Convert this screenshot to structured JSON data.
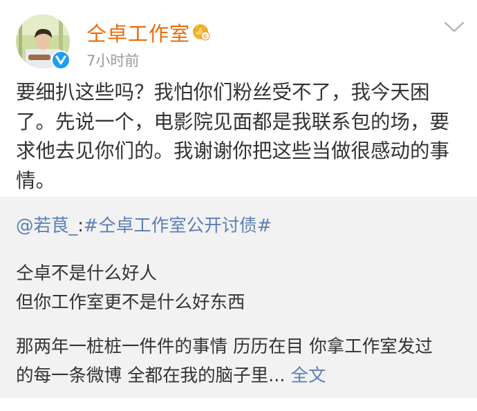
{
  "author": {
    "name": "仝卓工作室",
    "time": "7小时前",
    "vip_level": "6"
  },
  "post": {
    "line1": "要细扒这些吗？我怕你们粉丝受不了，我今天困",
    "line2": "了。先说一个，电影院见面都是我联系包的场，要",
    "line3": "求他去见你们的。我谢谢你把这些当做很感动的事",
    "line4": "情。"
  },
  "repost": {
    "mention": "@若茛_",
    "separator": ":",
    "hashtag": "#仝卓工作室公开讨债#",
    "line1": "仝卓不是什么好人",
    "line2": "但你工作室更不是什么好东西",
    "line3": "那两年一桩桩一件件的事情 历历在目 你拿工作室发过",
    "line4": "的每一条微博 全都在我的脑子里...",
    "expand_label": "全文"
  },
  "colors": {
    "name": "#e86b0c",
    "link": "#5b7fb5",
    "verified": "#1d9ff0",
    "repost_bg": "#f2f2f2"
  },
  "icons": [
    "avatar",
    "verified-icon",
    "vip-crown-icon",
    "chevron-down-icon"
  ]
}
